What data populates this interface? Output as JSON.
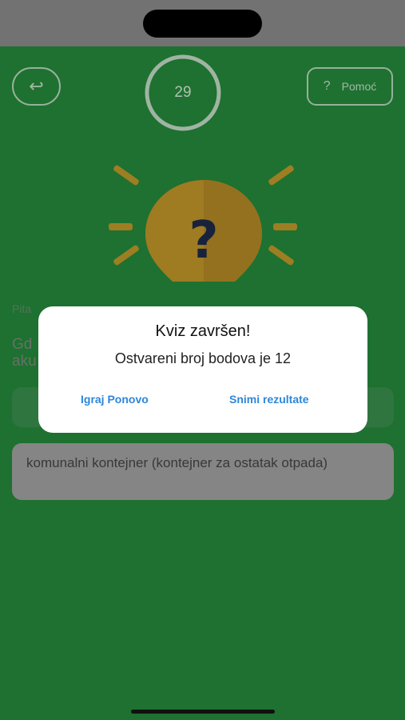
{
  "header": {
    "timer_value": "29",
    "help_label": "Pomoć",
    "help_icon": "question-mark-icon",
    "back_icon": "return-arrow-icon"
  },
  "quiz": {
    "question_number": "Pita",
    "question_text": "Gd\naku",
    "answers": [
      {
        "label": ""
      },
      {
        "label": "komunalni kontejner (kontejner za ostatak otpada)"
      }
    ]
  },
  "dialog": {
    "title": "Kviz završen!",
    "message": "Ostvareni broj bodova je 12",
    "play_again_label": "Igraj Ponovo",
    "save_results_label": "Snimi rezultate"
  },
  "colors": {
    "background_green": "#258a3b",
    "dialog_button_blue": "#2e86d9",
    "bulb_yellow": "#f5b82e"
  }
}
